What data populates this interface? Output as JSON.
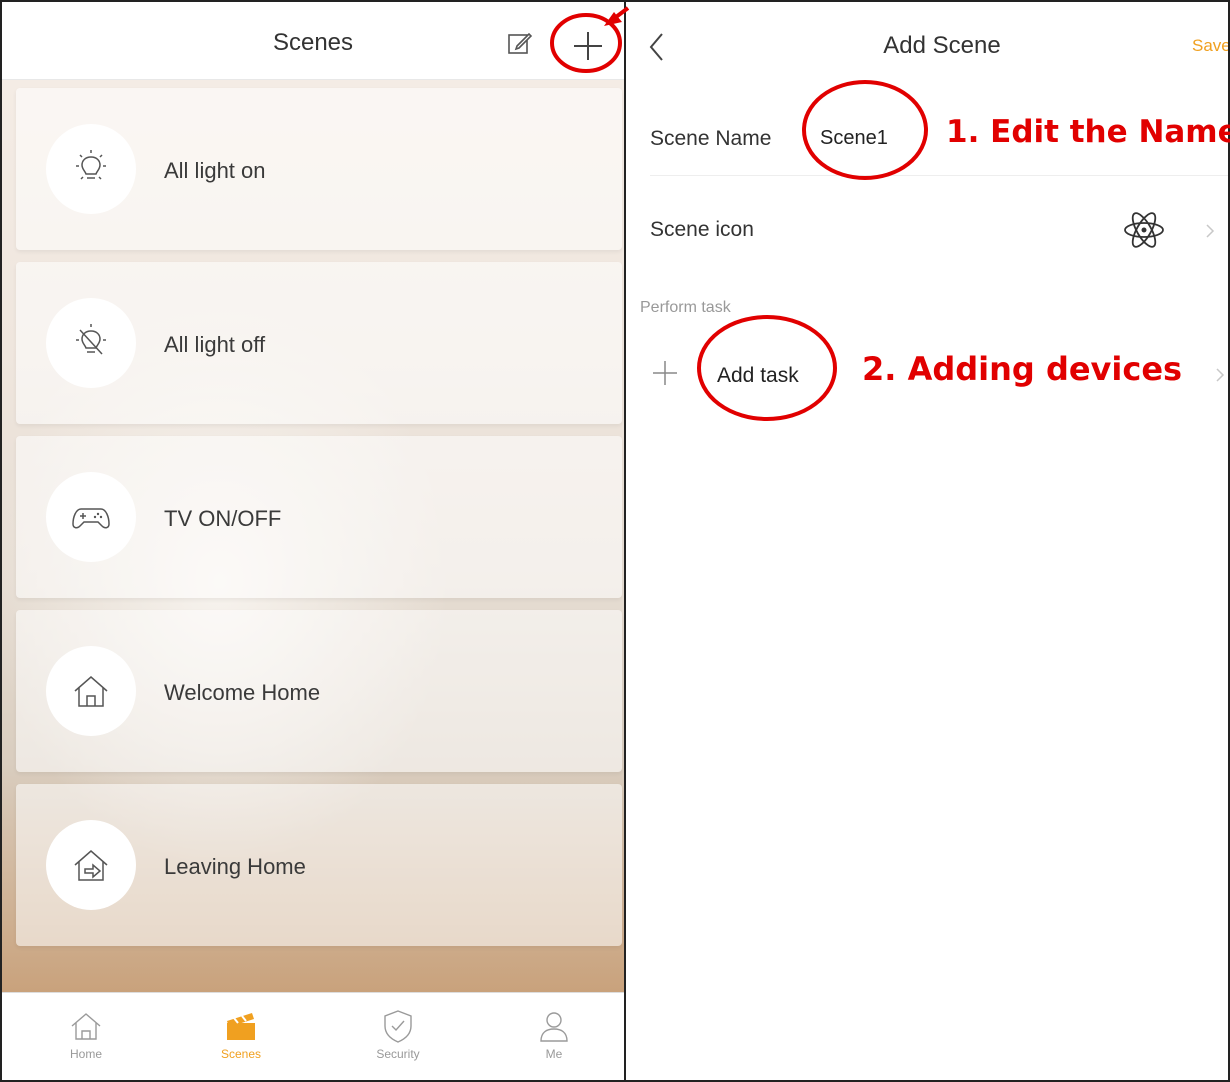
{
  "scenes_screen": {
    "title": "Scenes",
    "icons": {
      "edit": "edit-icon",
      "add": "plus-icon"
    },
    "scenes": [
      {
        "label": "All light on",
        "icon": "bulb-on-icon"
      },
      {
        "label": "All light off",
        "icon": "bulb-off-icon"
      },
      {
        "label": "TV ON/OFF",
        "icon": "gamepad-icon"
      },
      {
        "label": "Welcome Home",
        "icon": "home-icon"
      },
      {
        "label": "Leaving Home",
        "icon": "leave-home-icon"
      }
    ],
    "tabs": [
      {
        "label": "Home",
        "icon": "home-icon",
        "active": false
      },
      {
        "label": "Scenes",
        "icon": "clapperboard-icon",
        "active": true
      },
      {
        "label": "Security",
        "icon": "shield-check-icon",
        "active": false
      },
      {
        "label": "Me",
        "icon": "person-icon",
        "active": false
      }
    ]
  },
  "add_scene_screen": {
    "title": "Add Scene",
    "save_label": "Save",
    "scene_name_label": "Scene Name",
    "scene_name_value": "Scene1",
    "scene_icon_label": "Scene icon",
    "scene_icon": "atom-icon",
    "section_label": "Perform task",
    "add_task_label": "Add task"
  },
  "annotations": {
    "step1": "1. Edit the Name",
    "step2": "2. Adding devices"
  },
  "colors": {
    "accent": "#f0a020",
    "annotation": "#e10000",
    "text": "#333333",
    "muted": "#999999"
  }
}
